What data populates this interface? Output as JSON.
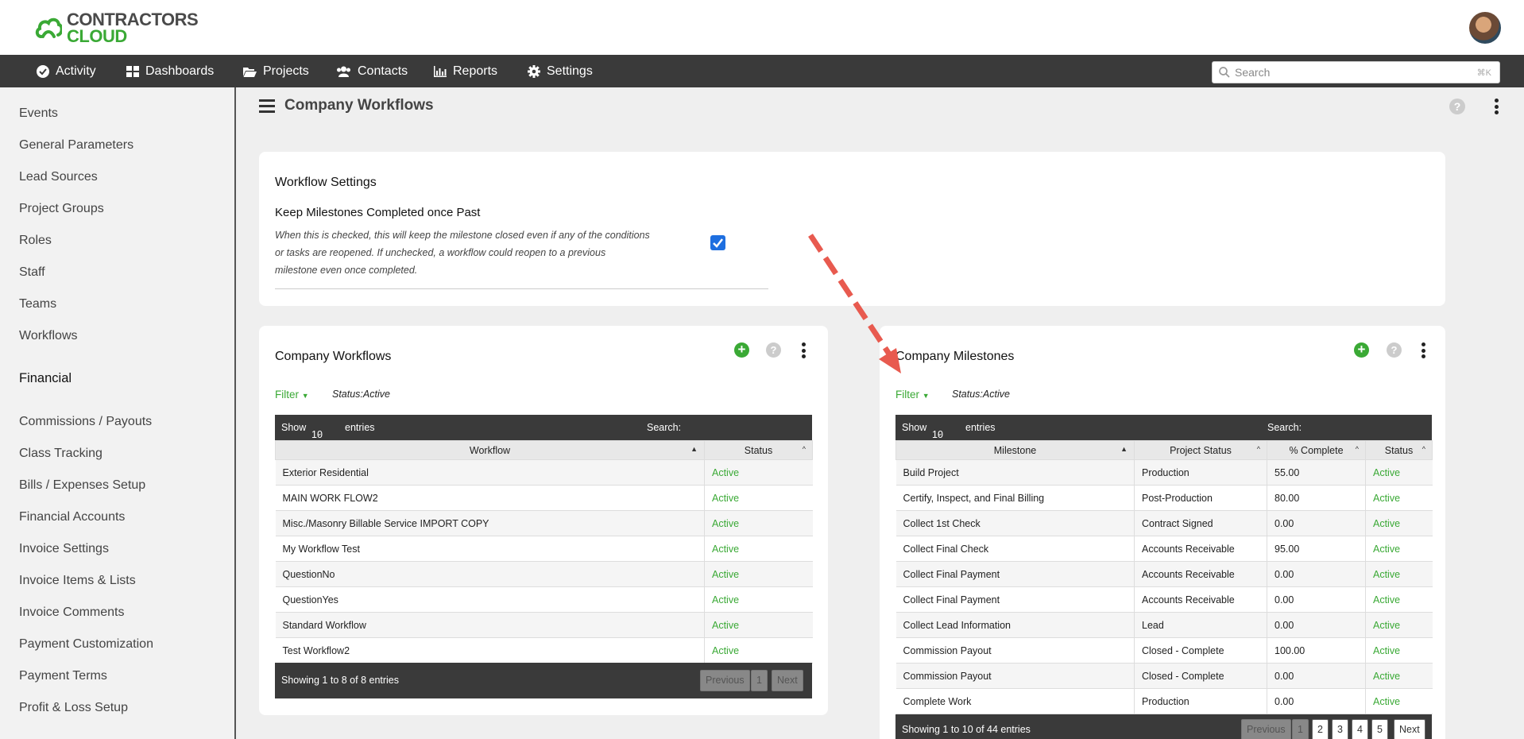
{
  "brand": {
    "line1": "CONTRACTORS",
    "line2": "CLOUD"
  },
  "nav": {
    "items": [
      "Activity",
      "Dashboards",
      "Projects",
      "Contacts",
      "Reports",
      "Settings"
    ],
    "search_placeholder": "Search",
    "shortcut": "⌘K"
  },
  "sidebar": {
    "items": [
      "Events",
      "General Parameters",
      "Lead Sources",
      "Project Groups",
      "Roles",
      "Staff",
      "Teams",
      "Workflows"
    ],
    "section_financial": "Financial",
    "financial_items": [
      "Commissions / Payouts",
      "Class Tracking",
      "Bills / Expenses Setup",
      "Financial Accounts",
      "Invoice Settings",
      "Invoice Items & Lists",
      "Invoice Comments",
      "Payment Customization",
      "Payment Terms",
      "Profit & Loss Setup"
    ]
  },
  "page": {
    "title": "Company Workflows",
    "help": "?"
  },
  "settings": {
    "title": "Workflow Settings",
    "option_label": "Keep Milestones Completed once Past",
    "option_desc_lines": [
      "When this is checked, this will keep the milestone closed even if any of the conditions",
      "or tasks are reopened. If unchecked, a workflow could reopen to a previous",
      "milestone even once completed."
    ],
    "option_checked": true
  },
  "workflows": {
    "title": "Company Workflows",
    "filter_label": "Filter",
    "filter_value": "Status:Active",
    "show_label": "Show",
    "show_value": "10",
    "entries_label": "entries",
    "search_label": "Search:",
    "columns": [
      "Workflow",
      "Status"
    ],
    "rows": [
      [
        "Exterior Residential",
        "Active"
      ],
      [
        "MAIN WORK FLOW2",
        "Active"
      ],
      [
        "Misc./Masonry Billable Service IMPORT COPY",
        "Active"
      ],
      [
        "My Workflow Test",
        "Active"
      ],
      [
        "QuestionNo",
        "Active"
      ],
      [
        "QuestionYes",
        "Active"
      ],
      [
        "Standard Workflow",
        "Active"
      ],
      [
        "Test Workflow2",
        "Active"
      ]
    ],
    "info": "Showing 1 to 8 of 8 entries",
    "pagination": {
      "previous": "Previous",
      "pages": [
        "1"
      ],
      "next": "Next"
    }
  },
  "milestones": {
    "title": "Company Milestones",
    "filter_label": "Filter",
    "filter_value": "Status:Active",
    "show_label": "Show",
    "show_value": "10",
    "entries_label": "entries",
    "search_label": "Search:",
    "columns": [
      "Milestone",
      "Project Status",
      "% Complete",
      "Status"
    ],
    "rows": [
      [
        "Build Project",
        "Production",
        "55.00",
        "Active"
      ],
      [
        "Certify, Inspect, and Final Billing",
        "Post-Production",
        "80.00",
        "Active"
      ],
      [
        "Collect 1st Check",
        "Contract Signed",
        "0.00",
        "Active"
      ],
      [
        "Collect Final Check",
        "Accounts Receivable",
        "95.00",
        "Active"
      ],
      [
        "Collect Final Payment",
        "Accounts Receivable",
        "0.00",
        "Active"
      ],
      [
        "Collect Final Payment",
        "Accounts Receivable",
        "0.00",
        "Active"
      ],
      [
        "Collect Lead Information",
        "Lead",
        "0.00",
        "Active"
      ],
      [
        "Commission Payout",
        "Closed - Complete",
        "100.00",
        "Active"
      ],
      [
        "Commission Payout",
        "Closed - Complete",
        "0.00",
        "Active"
      ],
      [
        "Complete Work",
        "Production",
        "0.00",
        "Active"
      ]
    ],
    "info": "Showing 1 to 10 of 44 entries",
    "pagination": {
      "previous": "Previous",
      "pages": [
        "1",
        "2",
        "3",
        "4",
        "5"
      ],
      "next": "Next"
    }
  },
  "colors": {
    "accent": "#3aa935",
    "navbar": "#3a3a3a",
    "arrow": "#e85a4f",
    "checkbox": "#1e6fe0"
  }
}
